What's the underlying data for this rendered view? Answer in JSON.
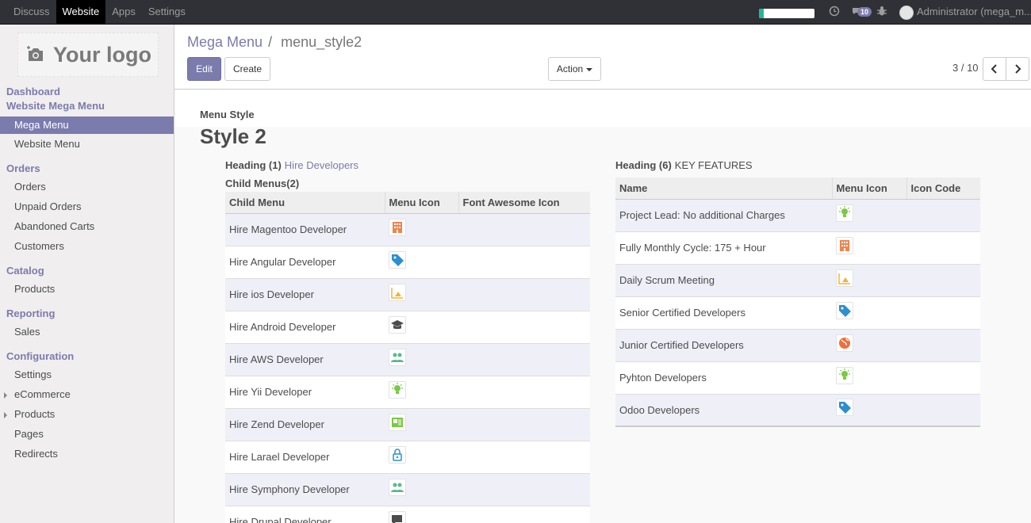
{
  "topnav": {
    "items": [
      "Discuss",
      "Website",
      "Apps",
      "Settings"
    ],
    "active": "Website",
    "messages_count": "10",
    "user": "Administrator (mega_m..."
  },
  "sidebar": {
    "logo_text": "Your logo",
    "heading_dashboard": "Dashboard",
    "heading_website_mega_menu": "Website Mega Menu",
    "item_mega_menu": "Mega Menu",
    "item_website_menu": "Website Menu",
    "heading_orders": "Orders",
    "item_orders": "Orders",
    "item_unpaid_orders": "Unpaid Orders",
    "item_abandoned_carts": "Abandoned Carts",
    "item_customers": "Customers",
    "heading_catalog": "Catalog",
    "item_products": "Products",
    "heading_reporting": "Reporting",
    "item_sales": "Sales",
    "heading_configuration": "Configuration",
    "item_settings": "Settings",
    "item_ecommerce": "eCommerce",
    "item_config_products": "Products",
    "item_pages": "Pages",
    "item_redirects": "Redirects"
  },
  "breadcrumb": {
    "parent": "Mega Menu",
    "separator": "/",
    "current": "menu_style2"
  },
  "buttons": {
    "edit": "Edit",
    "create": "Create",
    "action": "Action"
  },
  "pager": {
    "value": "3 / 10"
  },
  "form": {
    "menu_style_label": "Menu Style",
    "menu_style_value": "Style 2",
    "left_heading_label": "Heading (1)",
    "left_heading_value": "Hire Developers",
    "child_menus_label": "Child Menus(2)",
    "right_heading_label": "Heading (6)",
    "right_heading_value": "KEY FEATURES"
  },
  "child_table": {
    "columns": [
      "Child Menu",
      "Menu Icon",
      "Font Awesome Icon"
    ],
    "rows": [
      {
        "name": "Hire Magentoo Developer",
        "icon": "building-icon"
      },
      {
        "name": "Hire Angular Developer",
        "icon": "tag-icon"
      },
      {
        "name": "Hire ios Developer",
        "icon": "chart-icon"
      },
      {
        "name": "Hire Android Developer",
        "icon": "graduation-cap-icon"
      },
      {
        "name": "Hire AWS Developer",
        "icon": "users-icon"
      },
      {
        "name": "Hire Yii Developer",
        "icon": "bulb-icon"
      },
      {
        "name": "Hire Zend Developer",
        "icon": "id-card-icon"
      },
      {
        "name": "Hire Larael Developer",
        "icon": "lock-icon"
      },
      {
        "name": "Hire Symphony Developer",
        "icon": "users-icon"
      },
      {
        "name": "Hire Drupal Developer",
        "icon": "chat-icon"
      }
    ]
  },
  "features_table": {
    "columns": [
      "Name",
      "Menu Icon",
      "Icon Code"
    ],
    "rows": [
      {
        "name": "Project Lead: No additional Charges",
        "icon": "bulb-icon"
      },
      {
        "name": "Fully Monthly Cycle: 175 + Hour",
        "icon": "building-icon"
      },
      {
        "name": "Daily Scrum Meeting",
        "icon": "chart-icon"
      },
      {
        "name": "Senior Certified Developers",
        "icon": "tag-icon"
      },
      {
        "name": "Junior Certified Developers",
        "icon": "globe-icon"
      },
      {
        "name": "Pyhton Developers",
        "icon": "bulb-icon"
      },
      {
        "name": "Odoo Developers",
        "icon": "tag-icon"
      }
    ]
  },
  "colors": {
    "brand": "#7c7bad",
    "navbar": "#2f3136",
    "progress": "#21b799"
  }
}
